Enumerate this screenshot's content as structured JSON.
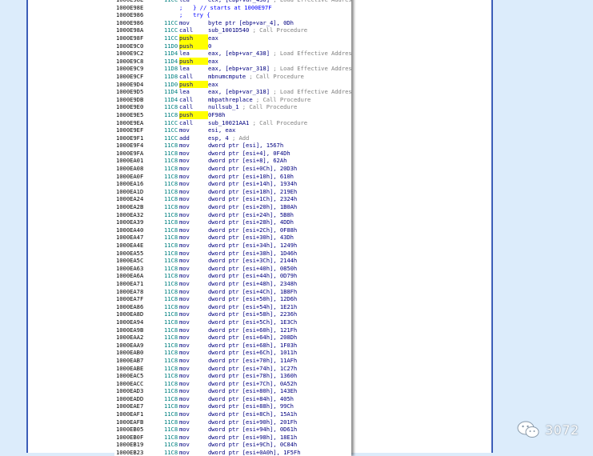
{
  "disassembly": {
    "lines": [
      {
        "addr": "1000E98E",
        "op": "11CC",
        "mn": "lea",
        "operand": "ecx, [ebp+var_430]",
        "comment": "; Load Effective Address"
      },
      {
        "addr": "1000E98E",
        "op": "",
        "mn": "",
        "operand": "",
        "source_comment": ";   } // starts at 1000E97F"
      },
      {
        "addr": "1000E986",
        "op": "",
        "mn": "",
        "operand": "",
        "source_comment": ";   try {"
      },
      {
        "addr": "1000E986",
        "op": "11CC",
        "mn": "mov",
        "operand": "byte ptr [ebp+var_4], 0Dh",
        "comment": ""
      },
      {
        "addr": "1000E98A",
        "op": "11CC",
        "mn": "call",
        "operand": "sub_1001D540",
        "comment": "; Call Procedure"
      },
      {
        "addr": "1000E98F",
        "op": "11CC",
        "mn": "push",
        "operand": "eax",
        "comment": "",
        "highlight": true
      },
      {
        "addr": "1000E9C0",
        "op": "11D0",
        "mn": "push",
        "operand": "0",
        "comment": "",
        "highlight": true
      },
      {
        "addr": "1000E9C2",
        "op": "11D4",
        "mn": "lea",
        "operand": "eax, [ebp+var_438]",
        "comment": "; Load Effective Address"
      },
      {
        "addr": "1000E9C8",
        "op": "11D4",
        "mn": "push",
        "operand": "eax",
        "comment": "",
        "highlight": true
      },
      {
        "addr": "1000E9C9",
        "op": "11D8",
        "mn": "lea",
        "operand": "eax, [ebp+var_318]",
        "comment": "; Load Effective Address"
      },
      {
        "addr": "1000E9CF",
        "op": "11D8",
        "mn": "call",
        "operand": "mbnumcmpute",
        "comment": "; Call Procedure"
      },
      {
        "addr": "1000E9D4",
        "op": "11D0",
        "mn": "push",
        "operand": "eax",
        "comment": "",
        "highlight": true
      },
      {
        "addr": "1000E9D5",
        "op": "11D4",
        "mn": "lea",
        "operand": "eax, [ebp+var_318]",
        "comment": "; Load Effective Address"
      },
      {
        "addr": "1000E9DB",
        "op": "11D4",
        "mn": "call",
        "operand": "mbpathreplace",
        "comment": "; Call Procedure"
      },
      {
        "addr": "1000E9E0",
        "op": "11C8",
        "mn": "call",
        "operand": "nullsub_1",
        "comment": "; Call Procedure"
      },
      {
        "addr": "1000E9E5",
        "op": "11C8",
        "mn": "push",
        "operand": "0F98h",
        "comment": "",
        "highlight": true
      },
      {
        "addr": "1000E9EA",
        "op": "11CC",
        "mn": "call",
        "operand": "sub_10021AA1",
        "comment": "; Call Procedure"
      },
      {
        "addr": "1000E9EF",
        "op": "11CC",
        "mn": "mov",
        "operand": "esi, eax",
        "comment": ""
      },
      {
        "addr": "1000E9F1",
        "op": "11CC",
        "mn": "add",
        "operand": "esp, 4",
        "comment": "; Add"
      },
      {
        "addr": "1000E9F4",
        "op": "11C8",
        "mn": "mov",
        "operand": "dword ptr [esi], 1567h",
        "comment": ""
      },
      {
        "addr": "1000E9FA",
        "op": "11C8",
        "mn": "mov",
        "operand": "dword ptr [esi+4], 0F4Dh",
        "comment": ""
      },
      {
        "addr": "1000EA01",
        "op": "11C8",
        "mn": "mov",
        "operand": "dword ptr [esi+8], 62Ah",
        "comment": ""
      },
      {
        "addr": "1000EA08",
        "op": "11C8",
        "mn": "mov",
        "operand": "dword ptr [esi+0Ch], 20D3h",
        "comment": ""
      },
      {
        "addr": "1000EA0F",
        "op": "11C8",
        "mn": "mov",
        "operand": "dword ptr [esi+10h], 610h",
        "comment": ""
      },
      {
        "addr": "1000EA16",
        "op": "11C8",
        "mn": "mov",
        "operand": "dword ptr [esi+14h], 1934h",
        "comment": ""
      },
      {
        "addr": "1000EA1D",
        "op": "11C8",
        "mn": "mov",
        "operand": "dword ptr [esi+18h], 219Eh",
        "comment": ""
      },
      {
        "addr": "1000EA24",
        "op": "11C8",
        "mn": "mov",
        "operand": "dword ptr [esi+1Ch], 2324h",
        "comment": ""
      },
      {
        "addr": "1000EA2B",
        "op": "11C8",
        "mn": "mov",
        "operand": "dword ptr [esi+20h], 1B0Ah",
        "comment": ""
      },
      {
        "addr": "1000EA32",
        "op": "11C8",
        "mn": "mov",
        "operand": "dword ptr [esi+24h], 5B8h",
        "comment": ""
      },
      {
        "addr": "1000EA39",
        "op": "11C8",
        "mn": "mov",
        "operand": "dword ptr [esi+28h], 4DDh",
        "comment": ""
      },
      {
        "addr": "1000EA40",
        "op": "11C8",
        "mn": "mov",
        "operand": "dword ptr [esi+2Ch], 0F88h",
        "comment": ""
      },
      {
        "addr": "1000EA47",
        "op": "11C8",
        "mn": "mov",
        "operand": "dword ptr [esi+30h], 43Dh",
        "comment": ""
      },
      {
        "addr": "1000EA4E",
        "op": "11C8",
        "mn": "mov",
        "operand": "dword ptr [esi+34h], 1249h",
        "comment": ""
      },
      {
        "addr": "1000EA55",
        "op": "11C8",
        "mn": "mov",
        "operand": "dword ptr [esi+38h], 1D46h",
        "comment": ""
      },
      {
        "addr": "1000EA5C",
        "op": "11C8",
        "mn": "mov",
        "operand": "dword ptr [esi+3Ch], 2144h",
        "comment": ""
      },
      {
        "addr": "1000EA63",
        "op": "11C8",
        "mn": "mov",
        "operand": "dword ptr [esi+40h], 0850h",
        "comment": ""
      },
      {
        "addr": "1000EA6A",
        "op": "11C8",
        "mn": "mov",
        "operand": "dword ptr [esi+44h], 0D79h",
        "comment": ""
      },
      {
        "addr": "1000EA71",
        "op": "11C8",
        "mn": "mov",
        "operand": "dword ptr [esi+48h], 2348h",
        "comment": ""
      },
      {
        "addr": "1000EA78",
        "op": "11C8",
        "mn": "mov",
        "operand": "dword ptr [esi+4Ch], 1B8Fh",
        "comment": ""
      },
      {
        "addr": "1000EA7F",
        "op": "11C8",
        "mn": "mov",
        "operand": "dword ptr [esi+50h], 12D6h",
        "comment": ""
      },
      {
        "addr": "1000EA86",
        "op": "11C8",
        "mn": "mov",
        "operand": "dword ptr [esi+54h], 1E21h",
        "comment": ""
      },
      {
        "addr": "1000EA8D",
        "op": "11C8",
        "mn": "mov",
        "operand": "dword ptr [esi+58h], 2236h",
        "comment": ""
      },
      {
        "addr": "1000EA94",
        "op": "11C8",
        "mn": "mov",
        "operand": "dword ptr [esi+5Ch], 1E3Ch",
        "comment": ""
      },
      {
        "addr": "1000EA9B",
        "op": "11C8",
        "mn": "mov",
        "operand": "dword ptr [esi+60h], 121Fh",
        "comment": ""
      },
      {
        "addr": "1000EAA2",
        "op": "11C8",
        "mn": "mov",
        "operand": "dword ptr [esi+64h], 208Dh",
        "comment": ""
      },
      {
        "addr": "1000EAA9",
        "op": "11C8",
        "mn": "mov",
        "operand": "dword ptr [esi+68h], 1F03h",
        "comment": ""
      },
      {
        "addr": "1000EAB0",
        "op": "11C8",
        "mn": "mov",
        "operand": "dword ptr [esi+6Ch], 1011h",
        "comment": ""
      },
      {
        "addr": "1000EAB7",
        "op": "11C8",
        "mn": "mov",
        "operand": "dword ptr [esi+70h], 11AFh",
        "comment": ""
      },
      {
        "addr": "1000EABE",
        "op": "11C8",
        "mn": "mov",
        "operand": "dword ptr [esi+74h], 1C27h",
        "comment": ""
      },
      {
        "addr": "1000EAC5",
        "op": "11C8",
        "mn": "mov",
        "operand": "dword ptr [esi+78h], 1360h",
        "comment": ""
      },
      {
        "addr": "1000EACC",
        "op": "11C8",
        "mn": "mov",
        "operand": "dword ptr [esi+7Ch], 0A52h",
        "comment": ""
      },
      {
        "addr": "1000EAD3",
        "op": "11C8",
        "mn": "mov",
        "operand": "dword ptr [esi+80h], 143Eh",
        "comment": ""
      },
      {
        "addr": "1000EADD",
        "op": "11C8",
        "mn": "mov",
        "operand": "dword ptr [esi+84h], 405h",
        "comment": ""
      },
      {
        "addr": "1000EAE7",
        "op": "11C8",
        "mn": "mov",
        "operand": "dword ptr [esi+88h], 99Ch",
        "comment": ""
      },
      {
        "addr": "1000EAF1",
        "op": "11C8",
        "mn": "mov",
        "operand": "dword ptr [esi+8Ch], 15A1h",
        "comment": ""
      },
      {
        "addr": "1000EAFB",
        "op": "11C8",
        "mn": "mov",
        "operand": "dword ptr [esi+90h], 201Fh",
        "comment": ""
      },
      {
        "addr": "1000EB05",
        "op": "11C8",
        "mn": "mov",
        "operand": "dword ptr [esi+94h], 0D61h",
        "comment": ""
      },
      {
        "addr": "1000EB0F",
        "op": "11C8",
        "mn": "mov",
        "operand": "dword ptr [esi+98h], 18E1h",
        "comment": ""
      },
      {
        "addr": "1000EB19",
        "op": "11C8",
        "mn": "mov",
        "operand": "dword ptr [esi+9Ch], 0C84h",
        "comment": ""
      },
      {
        "addr": "1000EB23",
        "op": "11C8",
        "mn": "mov",
        "operand": "dword ptr [esi+0A0h], 1F5Fh",
        "comment": ""
      }
    ]
  },
  "watermark": {
    "icon": "wechat-icon",
    "text": "3072"
  },
  "colors": {
    "frame": "#3b5db8",
    "push_highlight": "#ffff00",
    "opcode": "#008080",
    "comment": "#808080"
  }
}
